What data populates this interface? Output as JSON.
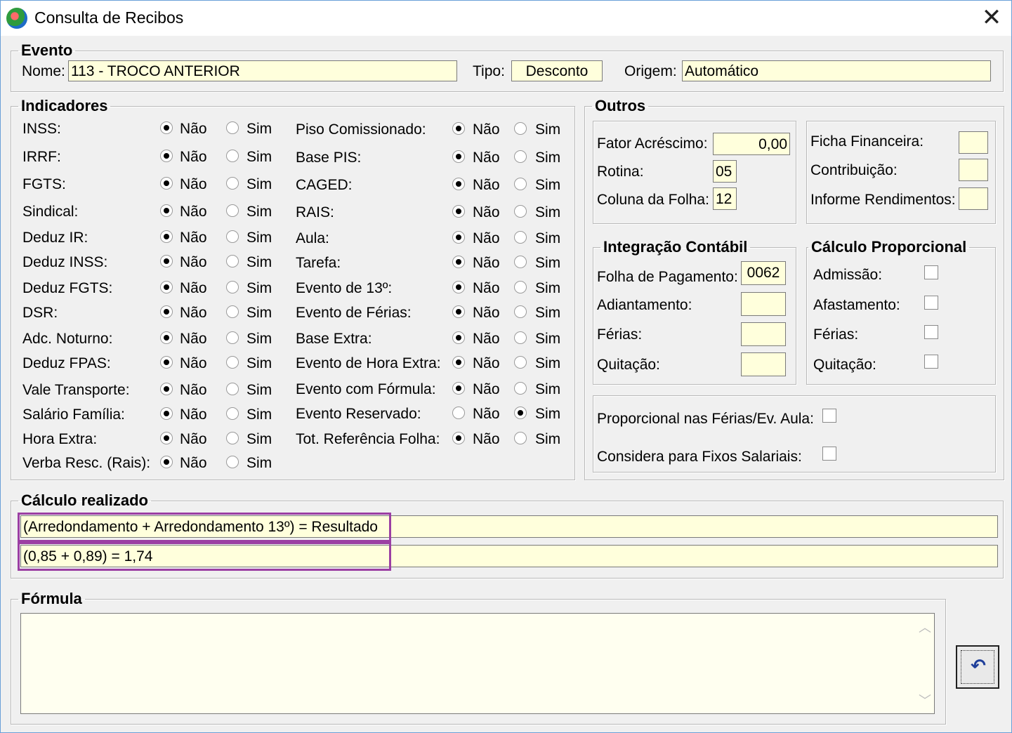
{
  "window": {
    "title": "Consulta de Recibos",
    "close_glyph": "✕"
  },
  "evento": {
    "legend": "Evento",
    "nome_label": "Nome:",
    "nome_value": "113 - TROCO ANTERIOR",
    "tipo_label": "Tipo:",
    "tipo_value": "Desconto",
    "origem_label": "Origem:",
    "origem_value": "Automático"
  },
  "indicadores": {
    "legend": "Indicadores",
    "no_label": "Não",
    "yes_label": "Sim",
    "left": [
      {
        "label": "INSS:",
        "value": "Não"
      },
      {
        "label": "IRRF:",
        "value": "Não"
      },
      {
        "label": "FGTS:",
        "value": "Não"
      },
      {
        "label": "Sindical:",
        "value": "Não"
      },
      {
        "label": "Deduz IR:",
        "value": "Não"
      },
      {
        "label": "Deduz INSS:",
        "value": "Não"
      },
      {
        "label": "Deduz FGTS:",
        "value": "Não"
      },
      {
        "label": "DSR:",
        "value": "Não"
      },
      {
        "label": "Adc. Noturno:",
        "value": "Não"
      },
      {
        "label": "Deduz FPAS:",
        "value": "Não"
      },
      {
        "label": "Vale Transporte:",
        "value": "Não"
      },
      {
        "label": "Salário Família:",
        "value": "Não"
      },
      {
        "label": "Hora Extra:",
        "value": "Não"
      },
      {
        "label": "Verba Resc. (Rais):",
        "value": "Não"
      }
    ],
    "right": [
      {
        "label": "Piso Comissionado:",
        "value": "Não"
      },
      {
        "label": "Base PIS:",
        "value": "Não"
      },
      {
        "label": "CAGED:",
        "value": "Não"
      },
      {
        "label": "RAIS:",
        "value": "Não"
      },
      {
        "label": "Aula:",
        "value": "Não"
      },
      {
        "label": "Tarefa:",
        "value": "Não"
      },
      {
        "label": "Evento de 13º:",
        "value": "Não"
      },
      {
        "label": "Evento de Férias:",
        "value": "Não"
      },
      {
        "label": "Base Extra:",
        "value": "Não"
      },
      {
        "label": "Evento de Hora Extra:",
        "value": "Não"
      },
      {
        "label": "Evento com Fórmula:",
        "value": "Não"
      },
      {
        "label": "Evento Reservado:",
        "value": "Sim"
      },
      {
        "label": "Tot. Referência Folha:",
        "value": "Não"
      }
    ]
  },
  "outros": {
    "legend": "Outros",
    "fator_label": "Fator Acréscimo:",
    "fator_value": "0,00",
    "rotina_label": "Rotina:",
    "rotina_value": "05",
    "coluna_label": "Coluna da Folha:",
    "coluna_value": "12",
    "ficha_label": "Ficha Financeira:",
    "ficha_value": "",
    "contribuicao_label": "Contribuição:",
    "contribuicao_value": "",
    "informe_label": "Informe Rendimentos:",
    "informe_value": ""
  },
  "integracao": {
    "legend": "Integração Contábil",
    "folha_label": "Folha de Pagamento:",
    "folha_value": "0062",
    "adiantamento_label": "Adiantamento:",
    "adiantamento_value": "",
    "ferias_label": "Férias:",
    "ferias_value": "",
    "quitacao_label": "Quitação:",
    "quitacao_value": ""
  },
  "proporcional": {
    "legend": "Cálculo Proporcional",
    "admissao_label": "Admissão:",
    "admissao_checked": false,
    "afastamento_label": "Afastamento:",
    "afastamento_checked": false,
    "ferias_label": "Férias:",
    "ferias_checked": false,
    "quitacao_label": "Quitação:",
    "quitacao_checked": false
  },
  "extras": {
    "prop_ferias_label": "Proporcional nas Férias/Ev. Aula:",
    "prop_ferias_checked": false,
    "fixos_label": "Considera para Fixos Salariais:",
    "fixos_checked": false
  },
  "calculo": {
    "legend": "Cálculo realizado",
    "line1": "(Arredondamento + Arredondamento 13º) = Resultado",
    "line2": "(0,85 + 0,89) = 1,74",
    "highlight_color": "#9b3fa3"
  },
  "formula": {
    "legend": "Fórmula",
    "value": ""
  },
  "buttons": {
    "undo_icon": "undo-icon"
  },
  "colors": {
    "field_bg": "#ffffdc",
    "window_bg": "#f0f0f0"
  }
}
